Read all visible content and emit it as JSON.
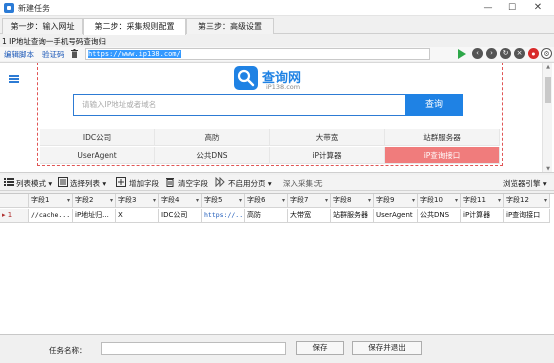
{
  "window": {
    "title": "新建任务",
    "minimize": "—",
    "maximize": "☐",
    "close": "✕"
  },
  "tabs": [
    {
      "label": "第一步：输入网址",
      "active": false
    },
    {
      "label": "第二步：采集规则配置",
      "active": true
    },
    {
      "label": "第三步：高级设置",
      "active": false
    }
  ],
  "url_caption": "1 IP地址查询一手机号码查询归",
  "script_toolbar": {
    "edit_script": "编辑脚本",
    "captcha": "验证码",
    "url": "https://www.ip138.com/"
  },
  "site": {
    "logo_title": "查询网",
    "logo_sub": "iP138.com",
    "search_placeholder": "请输入IP地址或者域名",
    "search_button": "查询",
    "links": [
      "IDC公司",
      "高防",
      "大带宽",
      "站群服务器",
      "UserAgent",
      "公共DNS",
      "iP计算器",
      "iP查询接口"
    ],
    "highlighted_link": "iP查询接口"
  },
  "field_toolbar": {
    "list_mode": "列表模式",
    "select_list": "选择列表",
    "add_field": "增加字段",
    "clear_fields": "清空字段",
    "paging": "不启用分页",
    "deep_collect_label": "深入采集：",
    "deep_collect_value": "无",
    "browser_engine": "浏览器引擎"
  },
  "grid": {
    "headers": [
      "字段1",
      "字段2",
      "字段3",
      "字段4",
      "字段5",
      "字段6",
      "字段7",
      "字段8",
      "字段9",
      "字段10",
      "字段11",
      "字段12"
    ],
    "rows": [
      {
        "index": "1",
        "cells": [
          "//cache...",
          "iP地址归...",
          "X",
          "IDC公司",
          "https://...",
          "高防",
          "大带宽",
          "站群服务器",
          "UserAgent",
          "公共DNS",
          "iP计算器",
          "iP查询接口"
        ]
      }
    ]
  },
  "bottom": {
    "task_name_label": "任务名称：",
    "task_name_value": "",
    "save_button": "保存",
    "save_exit_button": "保存并退出"
  },
  "colors": {
    "accent": "#1f82e4",
    "highlight": "#f07c7c",
    "link": "#1b58b8"
  }
}
